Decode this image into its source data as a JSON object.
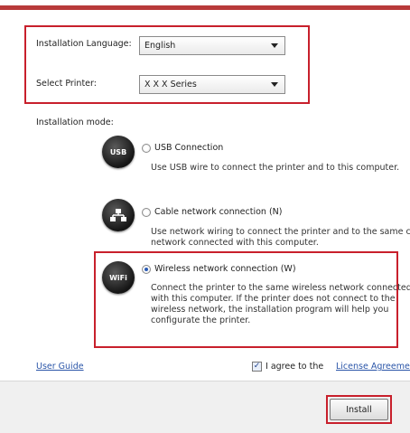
{
  "header": {
    "accent_color": "#b83a3a"
  },
  "setup": {
    "language_label": "Installation Language:",
    "language_value": "English",
    "printer_label": "Select Printer:",
    "printer_value": "X X X  Series",
    "mode_label": "Installation mode:"
  },
  "modes": [
    {
      "icon": "usb-icon",
      "icon_text": "USB",
      "label": "USB Connection",
      "selected": false,
      "desc": [
        "Use USB wire to connect the printer and to this computer."
      ]
    },
    {
      "icon": "network-icon",
      "icon_text": "",
      "label": "Cable network connection (N)",
      "selected": false,
      "desc": [
        "Use network wiring to connect the printer and to the same cable",
        "network connected with this computer."
      ]
    },
    {
      "icon": "wifi-icon",
      "icon_text": "WiFi",
      "label": "Wireless network connection (W)",
      "selected": true,
      "desc": [
        "Connect the printer to the same wireless network connected",
        "with this computer. If the printer does not connect to the",
        "wireless network, the installation program will help you",
        "configurate the printer."
      ]
    }
  ],
  "links": {
    "user_guide": "User Guide",
    "agree_prefix": "I agree to the ",
    "license": "License Agreement",
    "agree_checked": true
  },
  "footer": {
    "install_label": "Install"
  },
  "colors": {
    "highlight": "#c8202c",
    "link": "#2a55a8"
  }
}
